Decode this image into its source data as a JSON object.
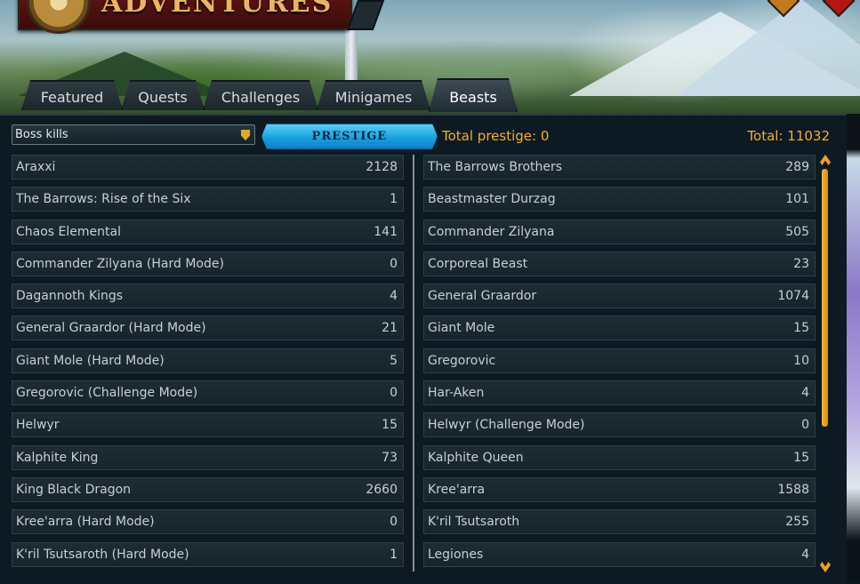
{
  "header": {
    "title": "ADVENTURES"
  },
  "tabs": [
    {
      "label": "Featured",
      "active": false
    },
    {
      "label": "Quests",
      "active": false
    },
    {
      "label": "Challenges",
      "active": false
    },
    {
      "label": "Minigames",
      "active": false
    },
    {
      "label": "Beasts",
      "active": true
    }
  ],
  "toolbar": {
    "category_select": "Boss kills",
    "prestige_button": "PRESTIGE",
    "total_prestige": "Total prestige: 0",
    "total": "Total: 11032"
  },
  "left_list": [
    {
      "name": "Araxxi",
      "count": "2128"
    },
    {
      "name": "The Barrows: Rise of the Six",
      "count": "1"
    },
    {
      "name": "Chaos Elemental",
      "count": "141"
    },
    {
      "name": "Commander Zilyana (Hard Mode)",
      "count": "0"
    },
    {
      "name": "Dagannoth Kings",
      "count": "4"
    },
    {
      "name": "General Graardor (Hard Mode)",
      "count": "21"
    },
    {
      "name": "Giant Mole (Hard Mode)",
      "count": "5"
    },
    {
      "name": "Gregorovic (Challenge Mode)",
      "count": "0"
    },
    {
      "name": "Helwyr",
      "count": "15"
    },
    {
      "name": "Kalphite King",
      "count": "73"
    },
    {
      "name": "King Black Dragon",
      "count": "2660"
    },
    {
      "name": "Kree'arra (Hard Mode)",
      "count": "0"
    },
    {
      "name": "K'ril Tsutsaroth (Hard Mode)",
      "count": "1"
    }
  ],
  "right_list": [
    {
      "name": "The Barrows Brothers",
      "count": "289"
    },
    {
      "name": "Beastmaster Durzag",
      "count": "101"
    },
    {
      "name": "Commander Zilyana",
      "count": "505"
    },
    {
      "name": "Corporeal Beast",
      "count": "23"
    },
    {
      "name": "General Graardor",
      "count": "1074"
    },
    {
      "name": "Giant Mole",
      "count": "15"
    },
    {
      "name": "Gregorovic",
      "count": "10"
    },
    {
      "name": "Har-Aken",
      "count": "4"
    },
    {
      "name": "Helwyr (Challenge Mode)",
      "count": "0"
    },
    {
      "name": "Kalphite Queen",
      "count": "15"
    },
    {
      "name": "Kree'arra",
      "count": "1588"
    },
    {
      "name": "K'ril Tsutsaroth",
      "count": "255"
    },
    {
      "name": "Legiones",
      "count": "4"
    }
  ],
  "icons": {
    "compass": "compass-icon",
    "select_arrow": "chevron-down-icon",
    "scroll_up": "chevron-up-icon",
    "scroll_down": "chevron-down-icon"
  },
  "colors": {
    "accent_gold": "#f2b124",
    "prestige_blue": "#19a1e0",
    "title_red": "#5a1410",
    "panel_bg": "#0e1a23"
  }
}
